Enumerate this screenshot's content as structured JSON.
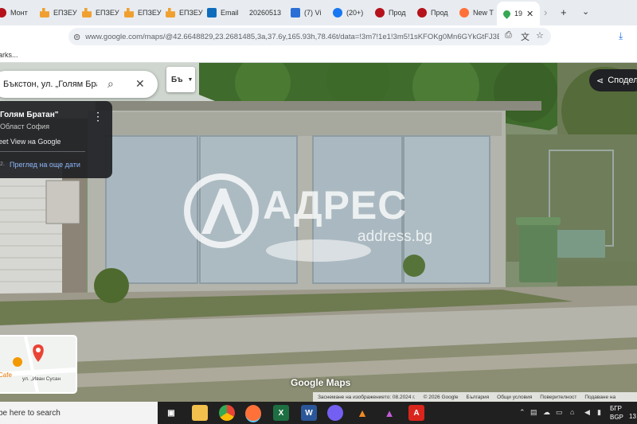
{
  "browser": {
    "tabs": [
      {
        "label": "Монт",
        "icon": "red-circle-icon"
      },
      {
        "label": "ЕПЗЕУ",
        "icon": "epzeu-icon"
      },
      {
        "label": "ЕПЗЕУ",
        "icon": "epzeu-icon"
      },
      {
        "label": "ЕПЗЕУ",
        "icon": "epzeu-icon"
      },
      {
        "label": "ЕПЗЕУ",
        "icon": "epzeu-icon"
      },
      {
        "label": "Email",
        "icon": "email-icon"
      },
      {
        "label": "20260513",
        "icon": ""
      },
      {
        "label": "(7) Vi",
        "icon": "vk-icon"
      },
      {
        "label": "(20+)",
        "icon": "facebook-icon"
      },
      {
        "label": "Прод",
        "icon": "red-circle-icon"
      },
      {
        "label": "Прод",
        "icon": "red-circle-icon"
      },
      {
        "label": "New T",
        "icon": "firefox-icon"
      },
      {
        "label": "19",
        "icon": "maps-pin-icon",
        "active": true
      }
    ],
    "url": "www.google.com/maps/@42.6648829,23.2681485,3a,37.6y,165.93h,78.46t/data=!3m7!1e1!3m5!1sKFOKg0Mn6GYkGtFJ3Eu",
    "bookmarks_label": "arks..."
  },
  "maps": {
    "search_value": "Бъкстон, ул. „Голям Бра",
    "language_button": "Бъ",
    "share_label": "Сподел",
    "card": {
      "title": "Голям Братан\"",
      "subtitle": "Област София",
      "street_view_label": "eet View на Google",
      "more_dates": "Преглед на още дати",
      "more_dates_prefix": "2."
    },
    "minimap": {
      "label_cafe": "Cafe",
      "label_street": "ул. „Иван Сусан"
    },
    "logo": "Google Maps",
    "footer": [
      "Заснемане на изображението: 08.2024 г.",
      "© 2026 Google",
      "България",
      "Общи условия",
      "Поверителност",
      "Подаване на"
    ],
    "watermark": {
      "brand": "АДРЕС",
      "site": "address.bg"
    }
  },
  "taskbar": {
    "search_placeholder": "be here to search",
    "apps": [
      "task-view",
      "file-explorer",
      "chrome",
      "firefox",
      "excel",
      "word",
      "viber",
      "vlc",
      "affinity",
      "acrobat"
    ],
    "lang_top": "БГР",
    "lang_bottom": "BGP",
    "clock": "13"
  },
  "colors": {
    "chrome_bg": "#e8ecf1",
    "taskbar": "#202020",
    "card_bg": "#202124",
    "link_blue": "#8ab4f8"
  }
}
